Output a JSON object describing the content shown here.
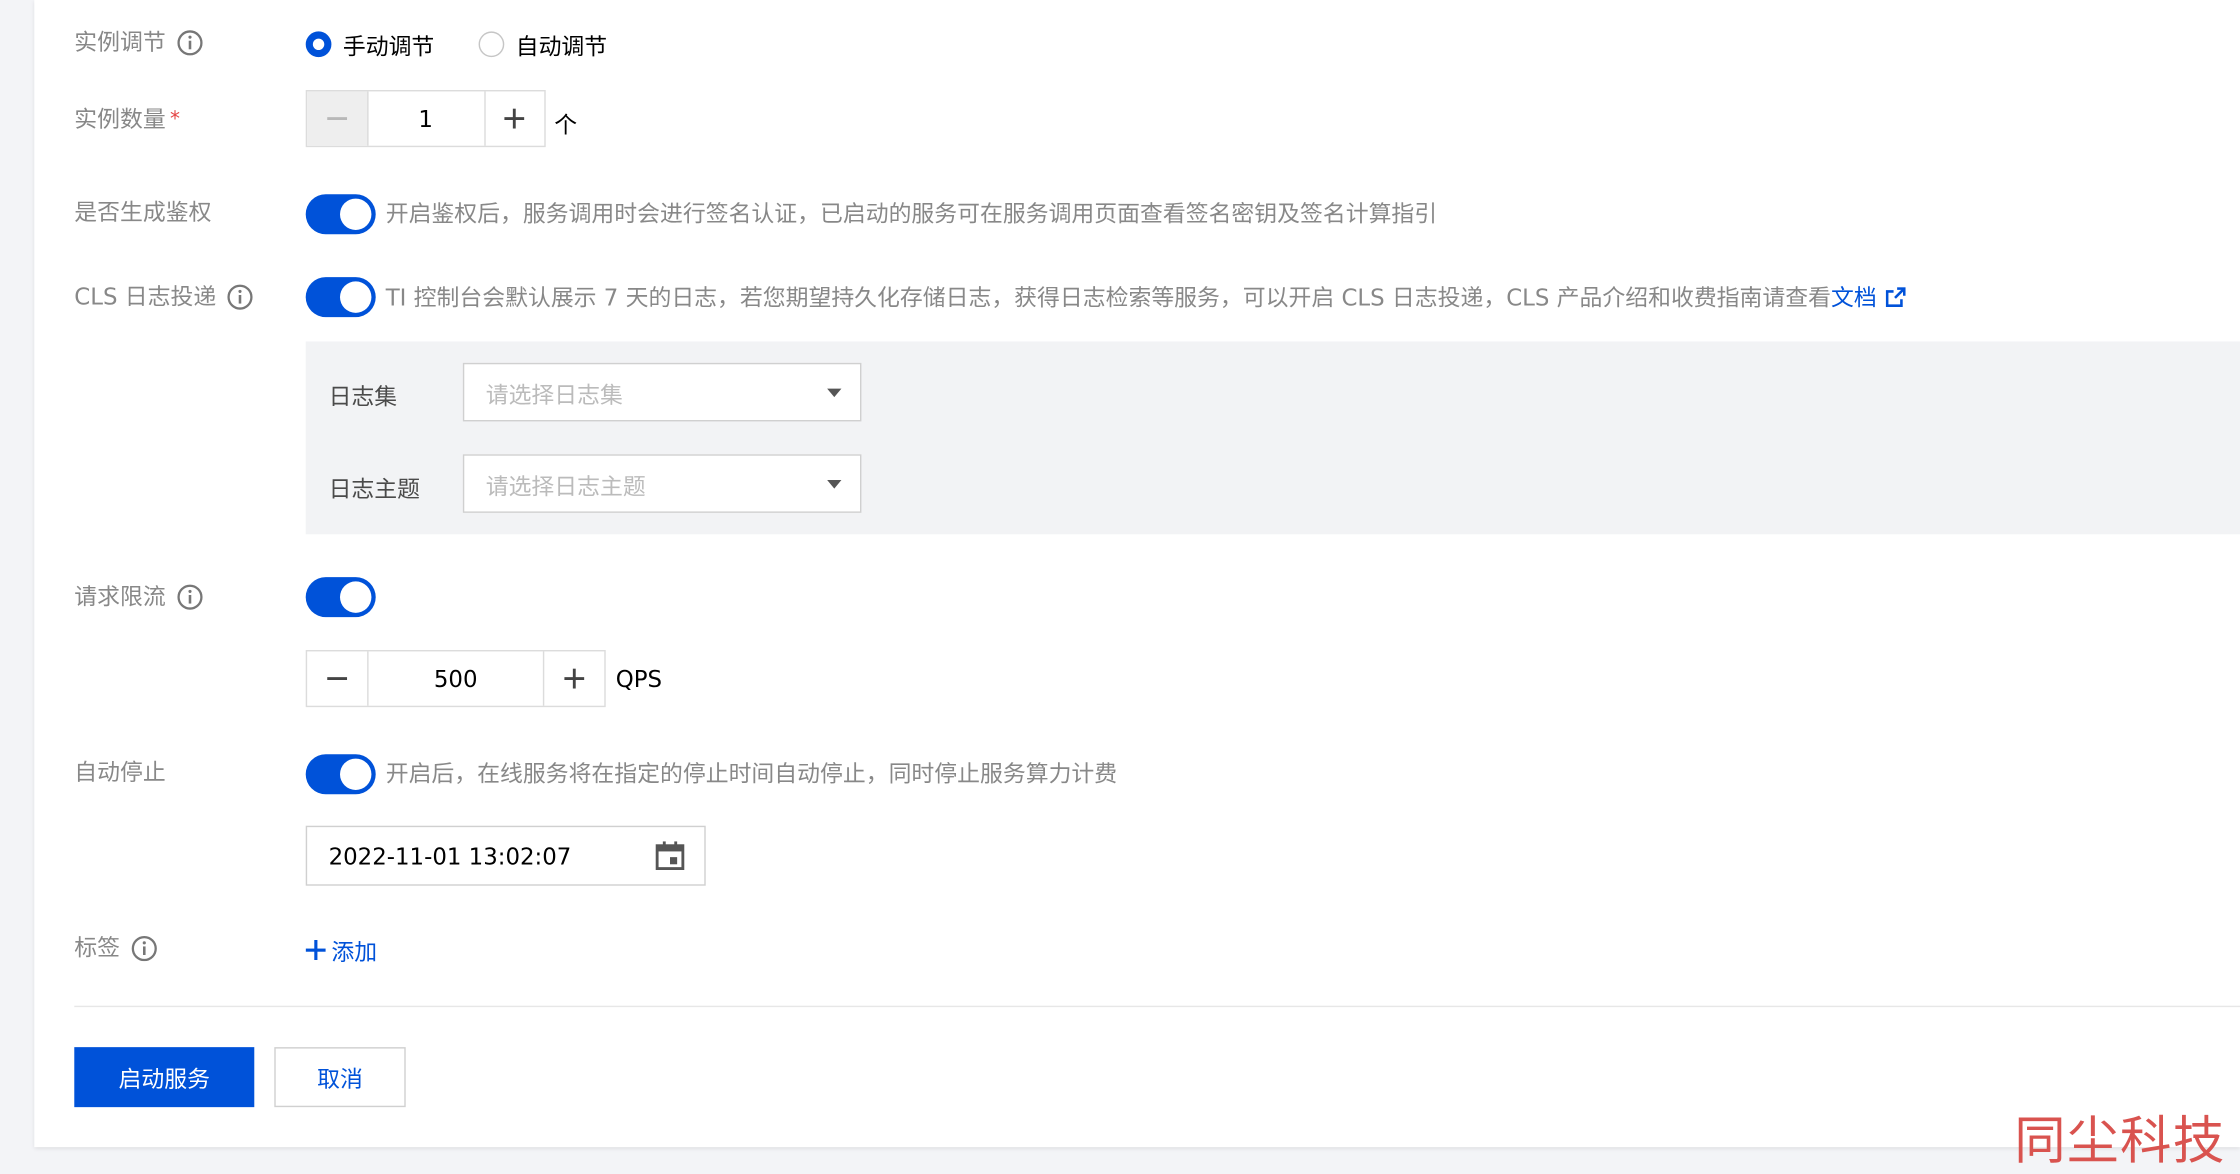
{
  "instance_adjust": {
    "label": "实例调节",
    "options": [
      "手动调节",
      "自动调节"
    ],
    "selected": "手动调节"
  },
  "instance_count": {
    "label": "实例数量",
    "required_mark": "*",
    "value": "1",
    "unit": "个"
  },
  "auth": {
    "label": "是否生成鉴权",
    "enabled": true,
    "hint": "开启鉴权后，服务调用时会进行签名认证，已启动的服务可在服务调用页面查看签名密钥及签名计算指引"
  },
  "cls": {
    "label": "CLS 日志投递",
    "enabled": true,
    "hint": "TI 控制台会默认展示 7 天的日志，若您期望持久化存储日志，获得日志检索等服务，可以开启 CLS 日志投递，CLS 产品介绍和收费指南请查看",
    "link_text": "文档",
    "logset_label": "日志集",
    "logset_placeholder": "请选择日志集",
    "topic_label": "日志主题",
    "topic_placeholder": "请选择日志主题"
  },
  "rate_limit": {
    "label": "请求限流",
    "enabled": true,
    "value": "500",
    "unit": "QPS"
  },
  "auto_stop": {
    "label": "自动停止",
    "enabled": true,
    "hint": "开启后，在线服务将在指定的停止时间自动停止，同时停止服务算力计费",
    "datetime": "2022-11-01 13:02:07"
  },
  "tags": {
    "label": "标签",
    "add_label": "添加"
  },
  "footer": {
    "submit_label": "启动服务",
    "cancel_label": "取消"
  },
  "watermark": "同尘科技",
  "colors": {
    "primary": "#0052d9",
    "required": "#e54545",
    "watermark": "#d9534f"
  }
}
